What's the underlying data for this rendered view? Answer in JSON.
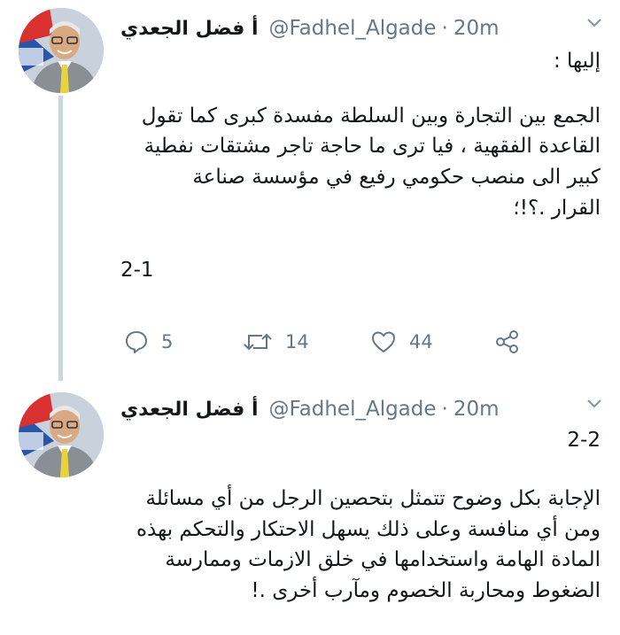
{
  "tweets": [
    {
      "display_name": "أ فضل الجعدي",
      "handle": "@Fadhel_Algade",
      "separator": "·",
      "time": "20m",
      "lines": [
        "إليها :",
        "الجمع بين التجارة وبين السلطة مفسدة كبرى كما تقول",
        "القاعدة الفقهية ، فيا ترى ما حاجة تاجر مشتقات نفطية",
        "كبير الى منصب حكومي رفيع في مؤسسة صناعة",
        "القرار .؟!؛"
      ],
      "numbering": "2-1",
      "actions": {
        "replies": "5",
        "retweets": "14",
        "likes": "44"
      }
    },
    {
      "display_name": "أ فضل الجعدي",
      "handle": "@Fadhel_Algade",
      "separator": "·",
      "time": "20m",
      "numbering": "2-2",
      "lines": [
        "الإجابة بكل وضوح تتمثل بتحصين الرجل من أي مسائلة",
        "ومن أي منافسة وعلى ذلك يسهل الاحتكار والتحكم بهذه",
        "المادة الهامة واستخدامها في خلق الازمات وممارسة",
        "الضغوط ومحاربة الخصوم ومآرب أخرى .!"
      ]
    }
  ]
}
